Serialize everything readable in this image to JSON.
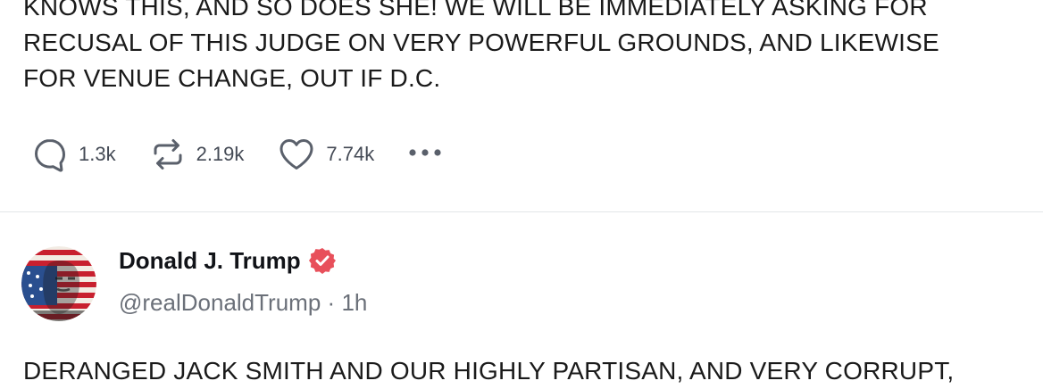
{
  "post1": {
    "text_lines": [
      "KNOWS THIS, AND SO DOES SHE! WE WILL BE IMMEDIATELY ASKING FOR",
      "RECUSAL OF THIS JUDGE ON VERY POWERFUL GROUNDS, AND LIKEWISE",
      "FOR VENUE CHANGE, OUT IF D.C."
    ],
    "actions": {
      "replies": "1.3k",
      "reposts": "2.19k",
      "likes": "7.74k"
    }
  },
  "post2": {
    "author_name": "Donald J. Trump",
    "handle": "@realDonaldTrump",
    "separator": "·",
    "time": "1h",
    "text_first_line": "DERANGED JACK SMITH AND OUR HIGHLY PARTISAN, AND VERY CORRUPT,"
  },
  "icons": {
    "reply": "speech-bubble-icon",
    "repost": "repost-arrows-icon",
    "like": "heart-icon",
    "more": "more-dots-icon",
    "verified": "verified-badge-icon"
  },
  "colors": {
    "verified_badge": "#e8505b",
    "meta_text": "#6b7079",
    "icon_gray": "#5a606b"
  }
}
